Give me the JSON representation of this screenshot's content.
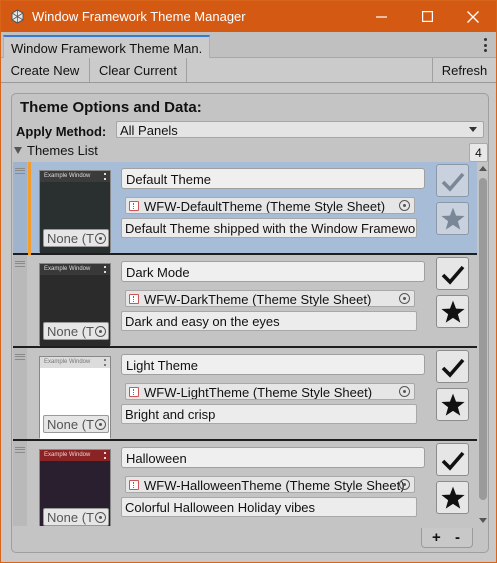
{
  "window": {
    "title": "Window Framework Theme Manager",
    "accent_color": "#d45a14",
    "icons": [
      "app-icon",
      "minimize-icon",
      "maximize-icon",
      "close-icon"
    ]
  },
  "tab": {
    "label": "Window Framework Theme Man.",
    "menu_icon": "kebab-menu-icon"
  },
  "toolbar": {
    "create_new": "Create New",
    "clear_current": "Clear Current",
    "refresh": "Refresh"
  },
  "panel": {
    "title": "Theme Options and Data:",
    "apply_method_label": "Apply Method:",
    "apply_method_value": "All Panels",
    "themes_list_label": "Themes List",
    "themes_count": "4"
  },
  "preview": {
    "window_label": "Example Window",
    "field_value": "None (T"
  },
  "themes": [
    {
      "name": "Default Theme",
      "sheet": "WFW-DefaultTheme (Theme Style Sheet)",
      "description": "Default Theme shipped with the Window Framework",
      "selected": true,
      "preview_head_color": "#3b3b3b",
      "preview_body_color": "#2a302f",
      "preview_head_text_color": "#dddddd"
    },
    {
      "name": "Dark Mode",
      "sheet": "WFW-DarkTheme (Theme Style Sheet)",
      "description": "Dark and easy on the eyes",
      "selected": false,
      "preview_head_color": "#383838",
      "preview_body_color": "#2b2b2b",
      "preview_head_text_color": "#dddddd"
    },
    {
      "name": "Light Theme",
      "sheet": "WFW-LightTheme (Theme Style Sheet)",
      "description": "Bright and crisp",
      "selected": false,
      "preview_head_color": "#dcdcdc",
      "preview_body_color": "#ffffff",
      "preview_head_text_color": "#777777"
    },
    {
      "name": "Halloween",
      "sheet": "WFW-HalloweenTheme (Theme Style Sheet)",
      "description": "Colorful Halloween Holiday vibes",
      "selected": false,
      "preview_head_color": "#8a2323",
      "preview_body_color": "#2a1f2e",
      "preview_head_text_color": "#f0d0d0"
    }
  ],
  "list_footer": {
    "add": "+",
    "remove": "-"
  }
}
